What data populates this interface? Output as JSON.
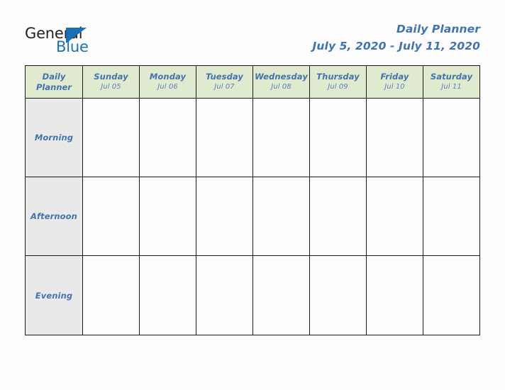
{
  "logo": {
    "word_one": "General",
    "word_two": "Blue",
    "mark": "triangle-flag-icon",
    "word_one_color": "#231f20",
    "word_two_color": "#1a6fb5",
    "mark_color": "#1a6fb5"
  },
  "header": {
    "title": "Daily Planner",
    "date_range": "July 5, 2020 - July 11, 2020",
    "title_color": "#4272b0"
  },
  "table": {
    "corner": {
      "line1": "Daily",
      "line2": "Planner"
    },
    "header_background": "#dfeacf",
    "slot_background": "#e9e9e9",
    "cell_background": "#fdfdfd",
    "border_color": "#1a1a1a",
    "days": [
      {
        "name": "Sunday",
        "date": "Jul 05"
      },
      {
        "name": "Monday",
        "date": "Jul 06"
      },
      {
        "name": "Tuesday",
        "date": "Jul 07"
      },
      {
        "name": "Wednesday",
        "date": "Jul 08"
      },
      {
        "name": "Thursday",
        "date": "Jul 09"
      },
      {
        "name": "Friday",
        "date": "Jul 10"
      },
      {
        "name": "Saturday",
        "date": "Jul 11"
      }
    ],
    "slots": [
      {
        "label": "Morning",
        "entries": [
          "",
          "",
          "",
          "",
          "",
          "",
          ""
        ]
      },
      {
        "label": "Afternoon",
        "entries": [
          "",
          "",
          "",
          "",
          "",
          "",
          ""
        ]
      },
      {
        "label": "Evening",
        "entries": [
          "",
          "",
          "",
          "",
          "",
          "",
          ""
        ]
      }
    ]
  }
}
